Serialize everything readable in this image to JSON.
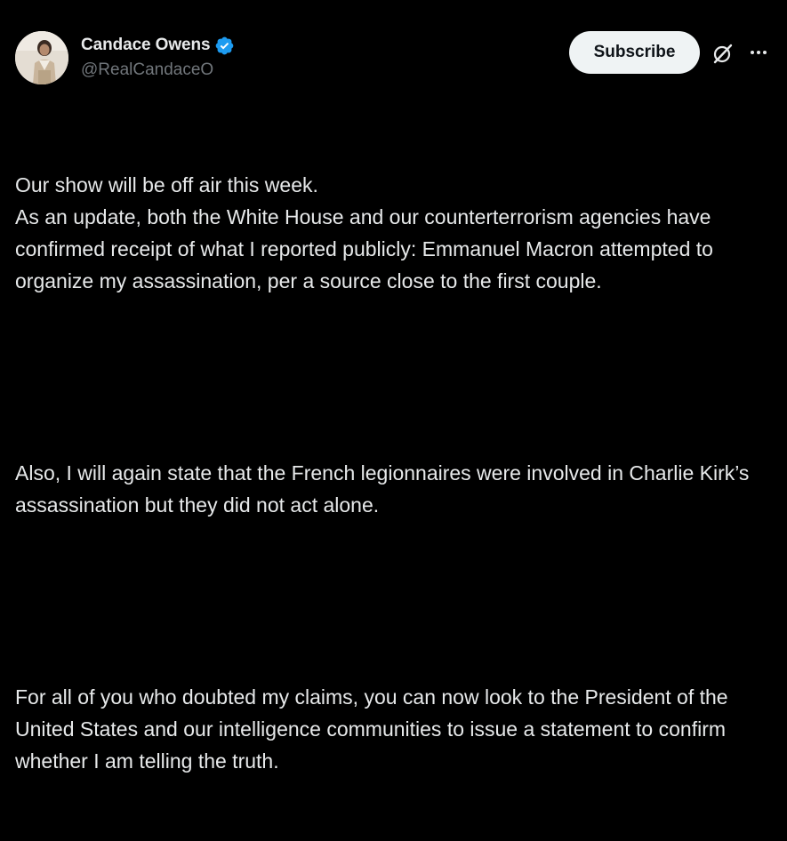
{
  "author": {
    "display_name": "Candace Owens",
    "handle": "@RealCandaceO",
    "verified": true,
    "verified_color": "#1d9bf0"
  },
  "actions": {
    "subscribe_label": "Subscribe",
    "grok_icon": "grok-icon",
    "more_icon": "more-icon"
  },
  "post": {
    "paragraphs": [
      "Our show will be off air this week.\nAs an update, both the White House and our counterterrorism agencies have confirmed receipt of what I reported publicly: Emmanuel Macron attempted to organize my assassination, per a source close to the first couple.",
      "Also, I will again state that the French legionnaires were involved in Charlie Kirk’s assassination but they did not act alone.",
      "For all of you who doubted my claims, you can now look to the President of the United States and our intelligence communities to issue a statement to confirm whether I am telling the truth."
    ]
  },
  "colors": {
    "background": "#000000",
    "text_primary": "#e7e9ea",
    "text_secondary": "#71767b",
    "button_bg": "#eff3f4",
    "button_text": "#0f1419"
  }
}
